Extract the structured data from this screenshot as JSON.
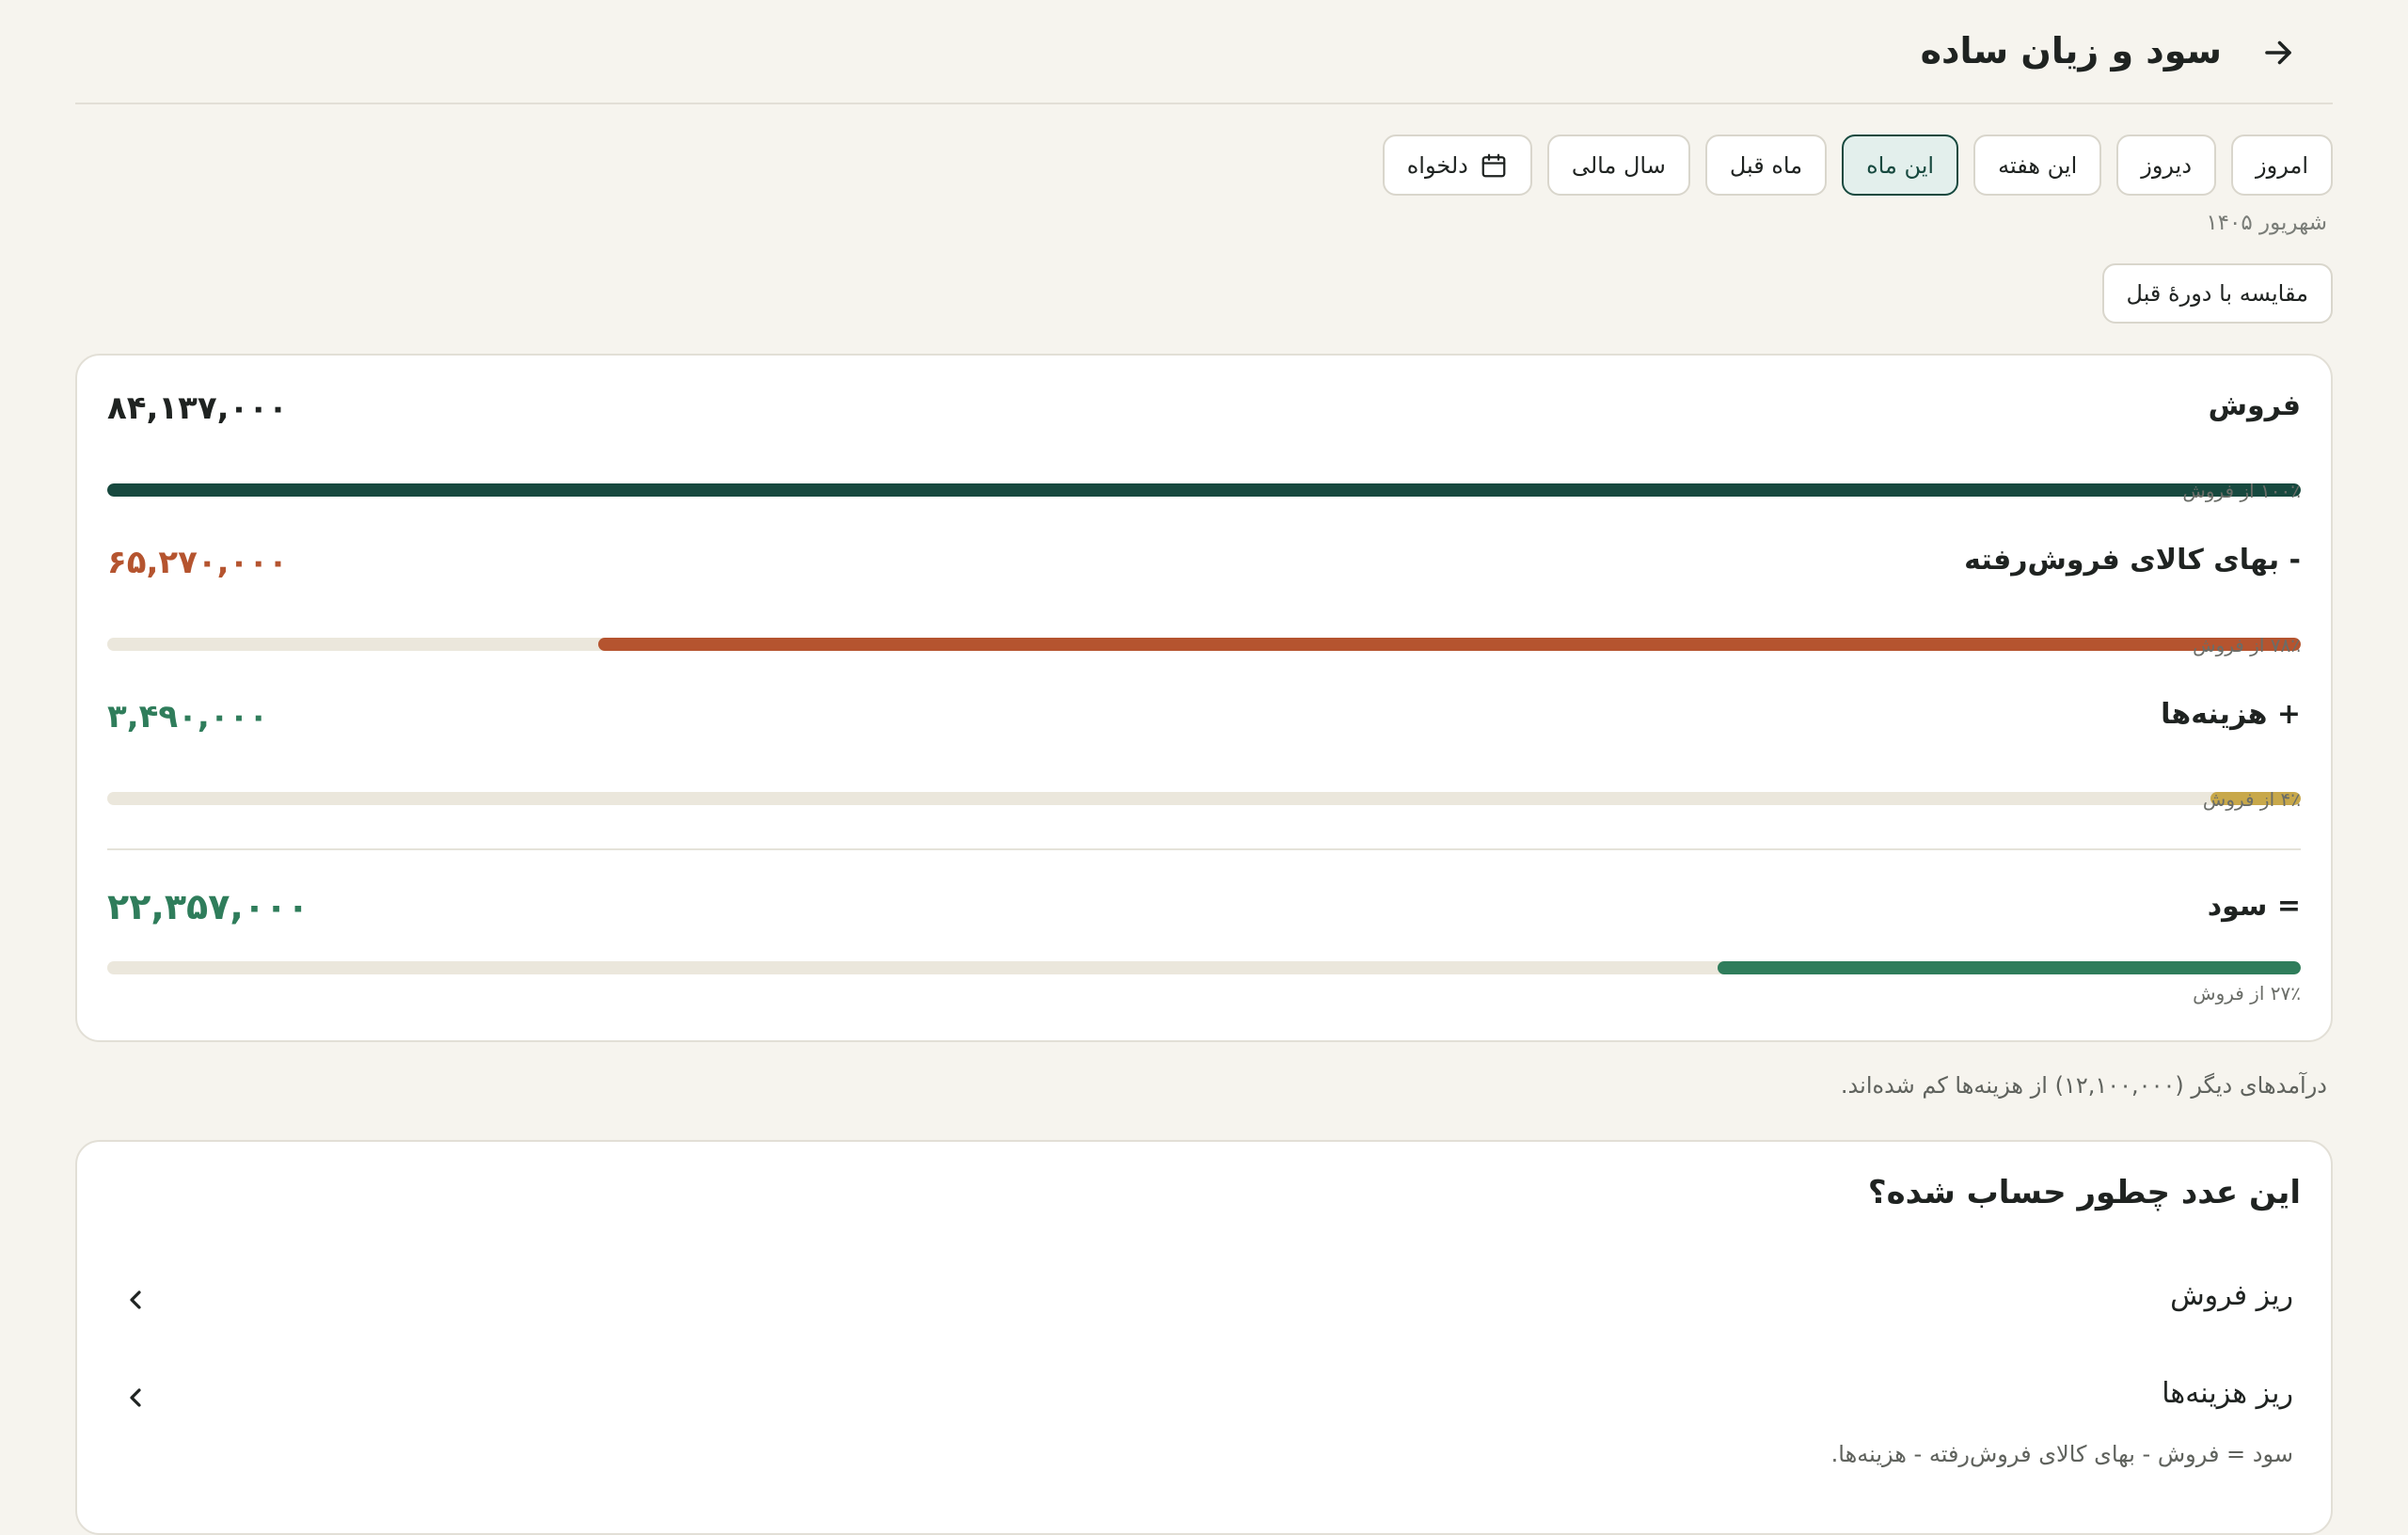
{
  "header": {
    "title": "سود و زیان ساده",
    "back_icon": "arrow-right-icon"
  },
  "periods": {
    "options": [
      "امروز",
      "دیروز",
      "این هفته",
      "این ماه",
      "ماه قبل",
      "سال مالی",
      "دلخواه"
    ],
    "selected": "این ماه",
    "custom_icon": "calendar-icon"
  },
  "period_label": "شهریور ۱۴۰۵",
  "compare_label": "مقایسه با دورهٔ قبل",
  "summary": {
    "rows": [
      {
        "label": "فروش",
        "value": "۸۴,۱۳۷,۰۰۰",
        "percent_text": "۱۰۰٪ از فروش",
        "share": 1.0,
        "value_color": "#1f2321",
        "bar_color": "#17493f"
      },
      {
        "label": "- بهای کالای فروش‌رفته",
        "value": "۶۵,۲۷۰,۰۰۰",
        "percent_text": "۷۸٪ از فروش",
        "share": 0.776,
        "value_color": "#b5542f",
        "bar_color": "#b5542f"
      },
      {
        "label": "+ هزینه‌ها",
        "value": "۳,۴۹۰,۰۰۰",
        "percent_text": "۴٪ از فروش",
        "share": 0.041,
        "value_color": "#2f7d5b",
        "bar_color": "#c8a84a"
      },
      {
        "label": "= سود",
        "value": "۲۲,۳۵۷,۰۰۰",
        "percent_text": "۲۷٪ از فروش",
        "share": 0.266,
        "value_color": "#2f7d5b",
        "bar_color": "#2f7d5b"
      }
    ]
  },
  "other_income_note": "درآمدهای دیگر (۱۲,۱۰۰,۰۰۰) از هزینه‌ها کم شده‌اند.",
  "explanation": {
    "title": "این عدد چطور حساب شده؟",
    "items": [
      {
        "label": "ریز فروش",
        "icon": "chevron-left-icon"
      },
      {
        "label": "ریز هزینه‌ها",
        "icon": "chevron-left-icon"
      }
    ],
    "formula": "سود = فروش - بهای کالای فروش‌رفته - هزینه‌ها."
  }
}
